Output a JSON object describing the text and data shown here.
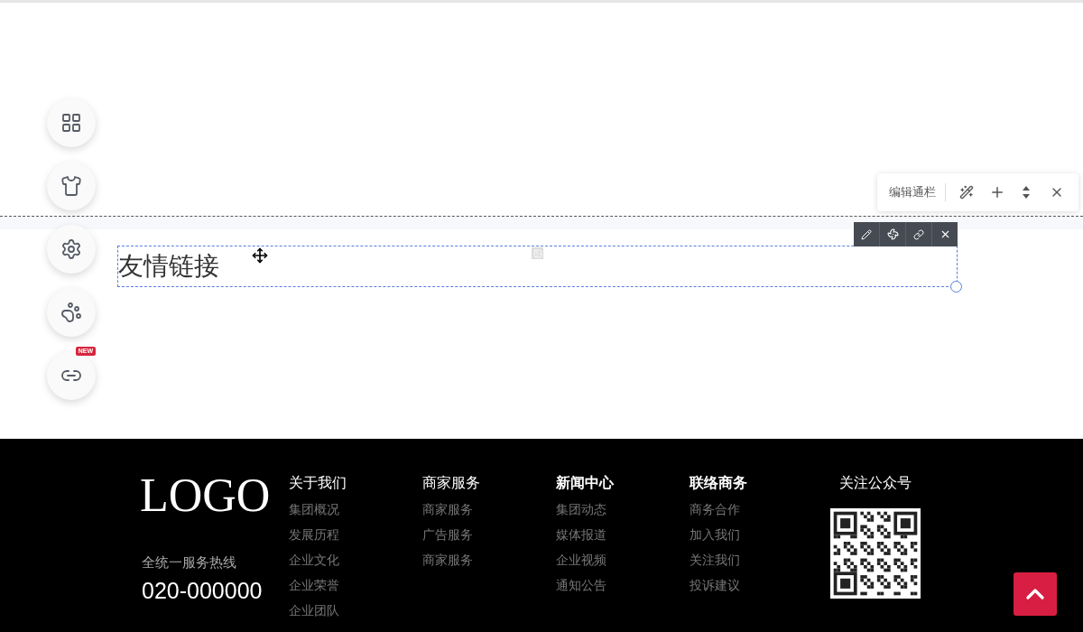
{
  "side_tools": [
    {
      "kind": "apps"
    },
    {
      "kind": "shirt"
    },
    {
      "kind": "settings"
    },
    {
      "kind": "paw"
    },
    {
      "kind": "link",
      "badge": "NEW"
    }
  ],
  "row_toolbar": {
    "title": "编辑通栏"
  },
  "module": {
    "title": "友情链接"
  },
  "footer": {
    "logo": "LOGO",
    "hotline_label": "全统一服务热线",
    "hotline": "020-000000",
    "columns": [
      {
        "title": "关于我们",
        "bold": false,
        "links": [
          "集团概况",
          "发展历程",
          "企业文化",
          "企业荣誉",
          "企业团队"
        ]
      },
      {
        "title": "商家服务",
        "bold": false,
        "links": [
          "商家服务",
          "广告服务",
          "商家服务"
        ]
      },
      {
        "title": "新闻中心",
        "bold": true,
        "links": [
          "集团动态",
          "媒体报道",
          "企业视频",
          "通知公告"
        ]
      },
      {
        "title": "联络商务",
        "bold": true,
        "links": [
          "商务合作",
          "加入我们",
          "关注我们",
          "投诉建议"
        ]
      }
    ],
    "follow": {
      "title": "关注公众号"
    }
  }
}
